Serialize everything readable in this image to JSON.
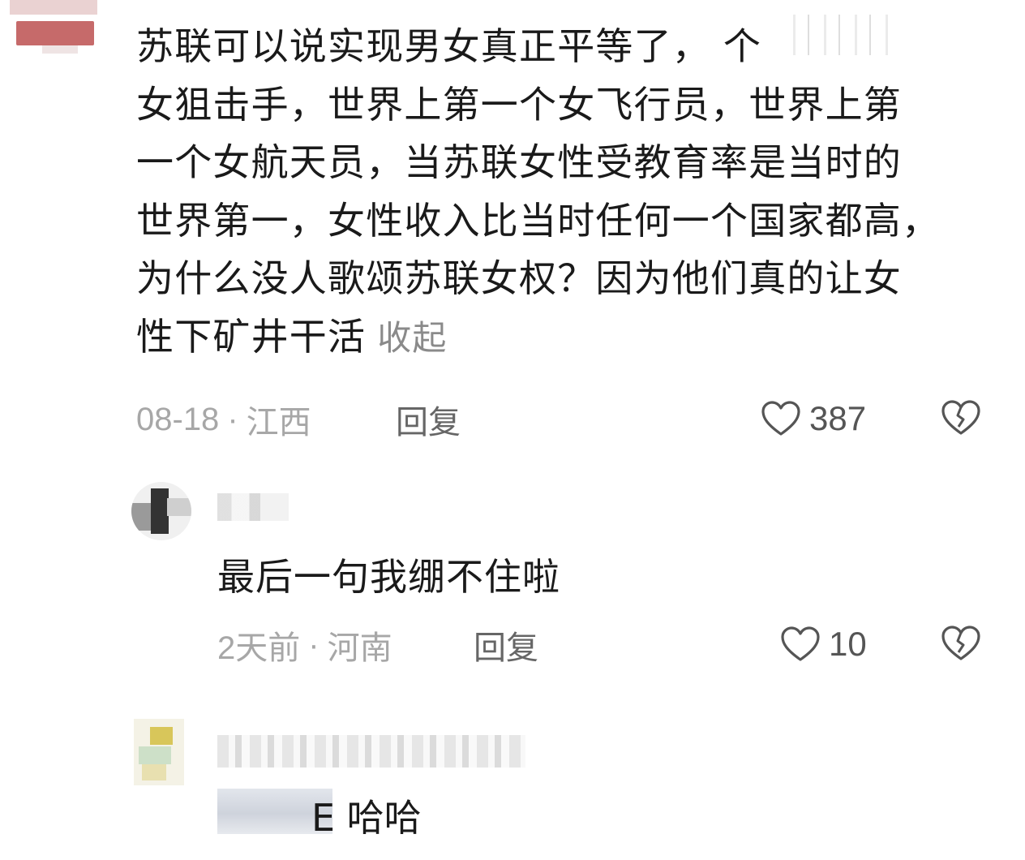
{
  "comments": [
    {
      "text_lines": [
        "苏联可以说实现男女真正平等了，                 个",
        "女狙击手，世界上第一个女飞行员，世界上第",
        "一个女航天员，当苏联女性受教育率是当时的",
        "世界第一，女性收入比当时任何一个国家都高，",
        "为什么没人歌颂苏联女权？因为他们真的让女",
        "性下矿井干活"
      ],
      "collapse_label": "收起",
      "date": "08-18",
      "location": "江西",
      "reply_label": "回复",
      "like_count": "387"
    },
    {
      "text": "最后一句我绷不住啦",
      "date": "2天前",
      "location": "河南",
      "reply_label": "回复",
      "like_count": "10"
    },
    {
      "text_visible": "E 哈哈"
    }
  ],
  "icons": {
    "like": "heart-outline-icon",
    "dislike": "broken-heart-icon"
  },
  "colors": {
    "text": "#1a1a1a",
    "meta": "#a7a7a7",
    "reply": "#666666",
    "icon": "#555555"
  }
}
